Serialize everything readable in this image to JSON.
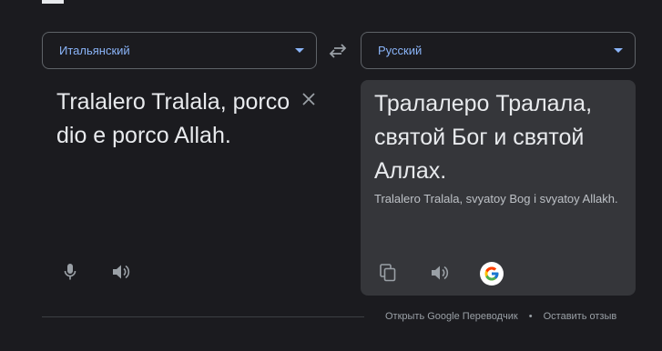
{
  "source_language": {
    "label": "Итальянский"
  },
  "target_language": {
    "label": "Русский"
  },
  "source": {
    "text": "Tralalero Tralala, porco dio e porco Allah."
  },
  "target": {
    "translation": "Тралалеро Тралала, святой Бог и святой Аллах.",
    "transliteration": "Tralalero Tralala, svyatoy Bog i svyatoy Allakh."
  },
  "footer": {
    "open_link": "Открыть Google Переводчик",
    "separator": "•",
    "feedback_link": "Оставить отзыв"
  },
  "colors": {
    "accent": "#8ab4f8",
    "background": "#1b1b1f",
    "panel": "#35363a",
    "text": "#e8eaed",
    "icon": "#9aa0a6"
  },
  "icons": {
    "swap": "swap-icon",
    "clear": "close-icon",
    "mic": "mic-icon",
    "speaker": "speaker-icon",
    "copy": "copy-icon",
    "google": "google-logo"
  }
}
